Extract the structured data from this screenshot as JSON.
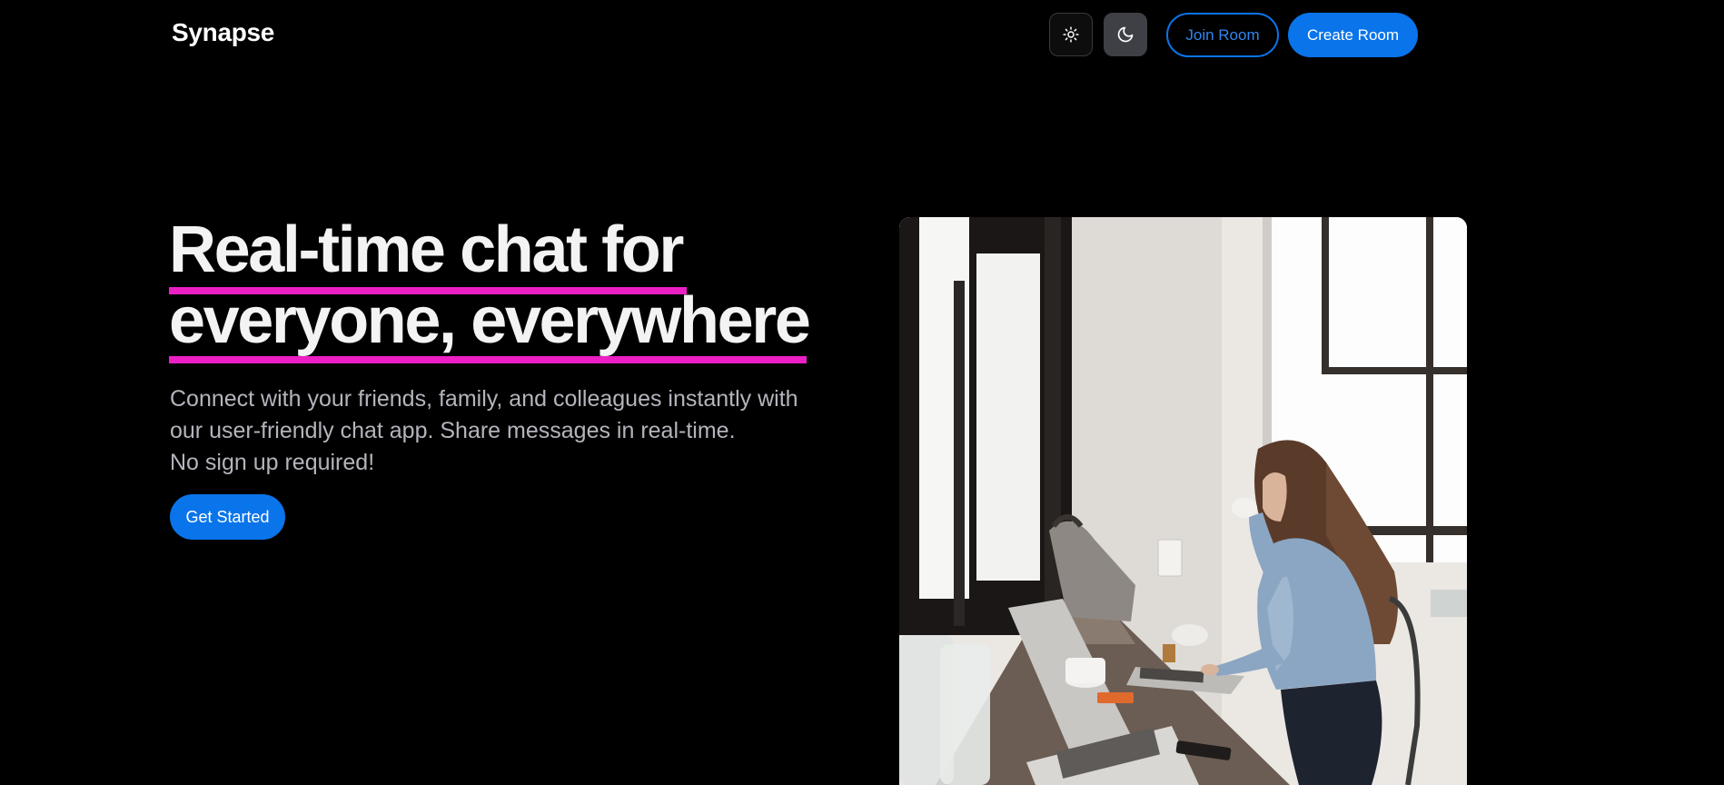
{
  "header": {
    "logo": "Synapse",
    "light_theme_icon": "sun-icon",
    "dark_theme_icon": "moon-icon",
    "join_label": "Join Room",
    "create_label": "Create Room"
  },
  "hero": {
    "title_line1": "Real-time chat for",
    "title_line2": "everyone, everywhere",
    "desc_line1": "Connect with your friends, family, and colleagues instantly with",
    "desc_line2": "our user-friendly chat app. Share messages in real-time.",
    "desc_line3": "No sign up required!",
    "cta_label": "Get Started"
  },
  "colors": {
    "accent": "#0a74ea",
    "highlight": "#ec1fc4",
    "background": "#000000"
  }
}
